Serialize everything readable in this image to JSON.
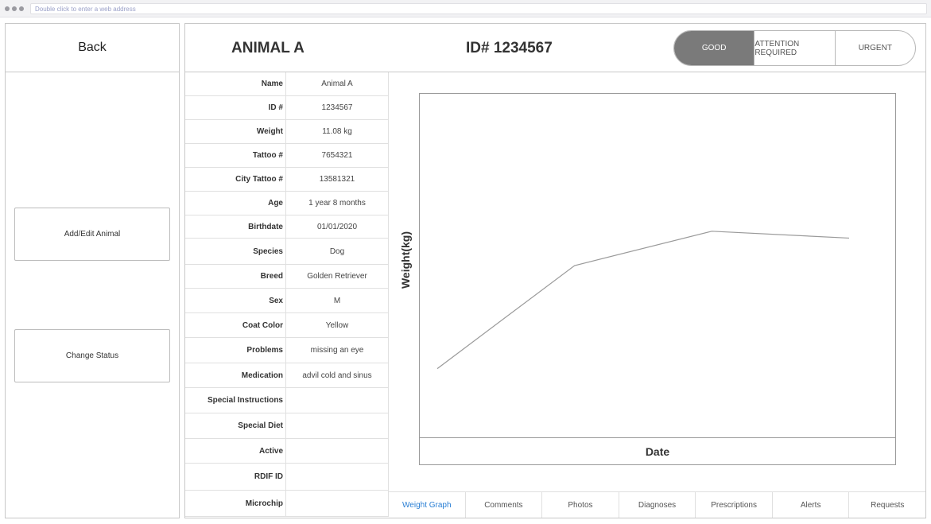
{
  "browser": {
    "address_placeholder": "Double click to enter a web address"
  },
  "sidebar": {
    "back_label": "Back",
    "add_edit_label": "Add/Edit Animal",
    "change_status_label": "Change Status"
  },
  "header": {
    "animal_name": "ANIMAL A",
    "animal_id": "ID# 1234567",
    "statuses": [
      {
        "label": "GOOD",
        "active": true
      },
      {
        "label": "ATTENTION REQUIRED",
        "active": false
      },
      {
        "label": "URGENT",
        "active": false
      }
    ]
  },
  "info": {
    "rows": [
      {
        "label": "Name",
        "value": "Animal A"
      },
      {
        "label": "ID #",
        "value": "1234567"
      },
      {
        "label": "Weight",
        "value": "11.08 kg"
      },
      {
        "label": "Tattoo #",
        "value": "7654321"
      },
      {
        "label": "City Tattoo #",
        "value": "13581321"
      },
      {
        "label": "Age",
        "value": "1 year 8 months"
      },
      {
        "label": "Birthdate",
        "value": "01/01/2020"
      },
      {
        "label": "Species",
        "value": "Dog"
      },
      {
        "label": "Breed",
        "value": "Golden Retriever"
      },
      {
        "label": "Sex",
        "value": "M"
      },
      {
        "label": "Coat Color",
        "value": "Yellow"
      },
      {
        "label": "Problems",
        "value": "missing an eye"
      },
      {
        "label": "Medication",
        "value": "advil cold and sinus"
      },
      {
        "label": "Special Instructions",
        "value": ""
      },
      {
        "label": "Special Diet",
        "value": ""
      },
      {
        "label": "Active",
        "value": ""
      },
      {
        "label": "RDIF ID",
        "value": ""
      },
      {
        "label": "Microchip",
        "value": ""
      }
    ]
  },
  "chart_data": {
    "type": "line",
    "xlabel": "Date",
    "ylabel": "Weight(kg)",
    "grid": false,
    "series": [
      {
        "values": [
          2.0,
          5.0,
          6.0,
          5.8
        ]
      }
    ],
    "ylim": [
      0,
      10
    ],
    "color": "#9a9a9a"
  },
  "tabs": [
    {
      "label": "Weight Graph",
      "active": true
    },
    {
      "label": "Comments",
      "active": false
    },
    {
      "label": "Photos",
      "active": false
    },
    {
      "label": "Diagnoses",
      "active": false
    },
    {
      "label": "Prescriptions",
      "active": false
    },
    {
      "label": "Alerts",
      "active": false
    },
    {
      "label": "Requests",
      "active": false
    }
  ],
  "colors": {
    "accent": "#2a7fd4",
    "status_active_bg": "#7a7a7a"
  }
}
